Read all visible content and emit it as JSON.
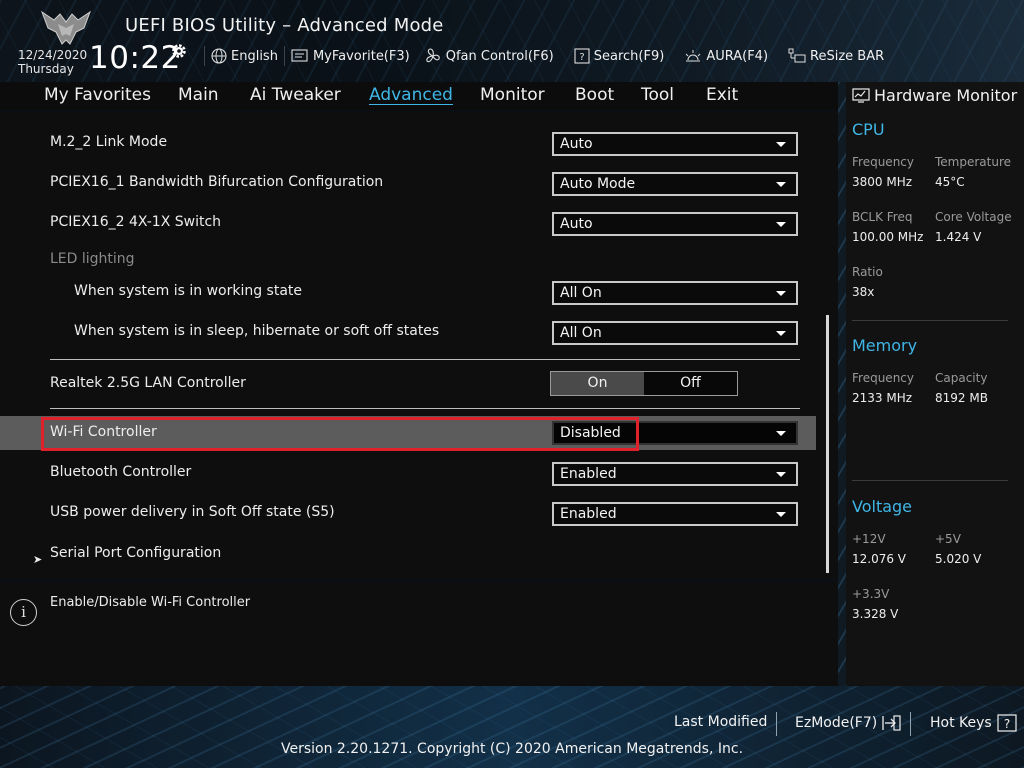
{
  "header": {
    "app_title": "UEFI BIOS Utility – Advanced Mode",
    "date": "12/24/2020",
    "day": "Thursday",
    "time": "10:22",
    "toolbar": [
      {
        "icon": "globe-icon",
        "label": "English"
      },
      {
        "icon": "favorite-icon",
        "label": "MyFavorite(F3)"
      },
      {
        "icon": "fan-icon",
        "label": "Qfan Control(F6)"
      },
      {
        "icon": "search-icon",
        "label": "Search(F9)"
      },
      {
        "icon": "aura-icon",
        "label": "AURA(F4)"
      },
      {
        "icon": "resize-bar-icon",
        "label": "ReSize BAR"
      }
    ]
  },
  "menu": {
    "items": [
      "My Favorites",
      "Main",
      "Ai Tweaker",
      "Advanced",
      "Monitor",
      "Boot",
      "Tool",
      "Exit"
    ],
    "active": "Advanced"
  },
  "settings": {
    "m2_link_mode": {
      "label": "M.2_2 Link Mode",
      "value": "Auto"
    },
    "pciex16_1_bifurcation": {
      "label": "PCIEX16_1 Bandwidth Bifurcation Configuration",
      "value": "Auto Mode"
    },
    "pciex16_2_switch": {
      "label": "PCIEX16_2 4X-1X Switch",
      "value": "Auto"
    },
    "led_lighting": {
      "label": "LED lighting"
    },
    "led_working": {
      "label": "When system is in working state",
      "value": "All On"
    },
    "led_sleep": {
      "label": "When system is in sleep, hibernate or soft off states",
      "value": "All On"
    },
    "realtek_lan": {
      "label": "Realtek 2.5G LAN Controller",
      "on_label": "On",
      "off_label": "Off",
      "selected": "On"
    },
    "wifi": {
      "label": "Wi-Fi Controller",
      "value": "Disabled"
    },
    "bluetooth": {
      "label": "Bluetooth Controller",
      "value": "Enabled"
    },
    "usb_power": {
      "label": "USB power delivery in Soft Off state (S5)",
      "value": "Enabled"
    },
    "serial_port": {
      "label": "Serial Port Configuration"
    }
  },
  "help": {
    "text": "Enable/Disable Wi-Fi Controller"
  },
  "hardware_monitor": {
    "title": "Hardware Monitor",
    "cpu": {
      "title": "CPU",
      "frequency_label": "Frequency",
      "frequency": "3800 MHz",
      "temperature_label": "Temperature",
      "temperature": "45°C",
      "bclk_label": "BCLK Freq",
      "bclk": "100.00 MHz",
      "core_voltage_label": "Core Voltage",
      "core_voltage": "1.424 V",
      "ratio_label": "Ratio",
      "ratio": "38x"
    },
    "memory": {
      "title": "Memory",
      "frequency_label": "Frequency",
      "frequency": "2133 MHz",
      "capacity_label": "Capacity",
      "capacity": "8192 MB"
    },
    "voltage": {
      "title": "Voltage",
      "v12_label": "+12V",
      "v12": "12.076 V",
      "v5_label": "+5V",
      "v5": "5.020 V",
      "v33_label": "+3.3V",
      "v33": "3.328 V"
    }
  },
  "footer": {
    "last_modified": "Last Modified",
    "ezmode": "EzMode(F7)",
    "hot_keys": "Hot Keys",
    "copyright": "Version 2.20.1271. Copyright (C) 2020 American Megatrends, Inc."
  },
  "colors": {
    "accent": "#3fb6e6",
    "highlight_border": "#e0202a"
  }
}
